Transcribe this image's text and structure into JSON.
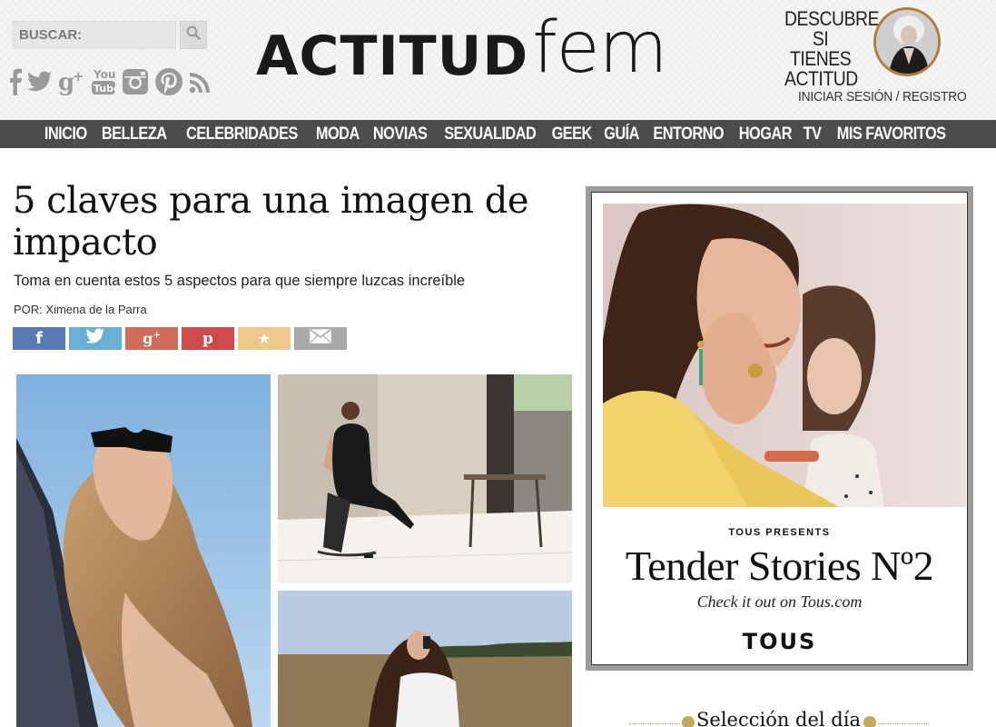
{
  "header": {
    "search": {
      "placeholder": "BUSCAR:"
    },
    "logo": {
      "bold": "ACTITUD",
      "light": "fem"
    },
    "promo": {
      "line1": "DESCUBRE",
      "line2": "SI TIENES",
      "line3": "ACTITUD"
    },
    "login": "INICIAR SESIÓN / REGISTRO",
    "social_icons": [
      "facebook-icon",
      "twitter-icon",
      "google-plus-icon",
      "youtube-icon",
      "instagram-icon",
      "pinterest-icon",
      "rss-icon"
    ],
    "youtube_you": "You",
    "youtube_tube": "Tube"
  },
  "nav": {
    "items": [
      "INICIO",
      "BELLEZA",
      "CELEBRIDADES",
      "MODA",
      "NOVIAS",
      "SEXUALIDAD",
      "GEEK",
      "GUÍA",
      "ENTORNO",
      "HOGAR",
      "TV",
      "MIS FAVORITOS"
    ]
  },
  "article": {
    "title": "5 claves para una imagen de impacto",
    "subtitle": "Toma en cuenta estos 5 aspectos para que siempre luzcas increíble",
    "author": "POR: Ximena de la Parra",
    "share": [
      {
        "name": "facebook",
        "glyph": "f",
        "color": "#5a7ab5"
      },
      {
        "name": "twitter",
        "glyph": "",
        "color": "#6aaed6"
      },
      {
        "name": "google-plus",
        "glyph": "g+",
        "color": "#d16c5b"
      },
      {
        "name": "pinterest",
        "glyph": "p",
        "color": "#cc4a4a"
      },
      {
        "name": "favorite",
        "glyph": "★",
        "color": "#ecc98a"
      },
      {
        "name": "email",
        "glyph": "",
        "color": "#a9a9a9"
      }
    ]
  },
  "ad": {
    "presents": "TOUS PRESENTS",
    "headline": "Tender Stories Nº2",
    "tagline": "Check it out on Tous.com",
    "brand": "TOUS"
  },
  "sidebar": {
    "seleccion": "Selección del día"
  },
  "colors": {
    "nav_bg": "#4c4c4c",
    "accent_gold": "#c6a75a",
    "ad_frame": "#9c9c9c"
  }
}
